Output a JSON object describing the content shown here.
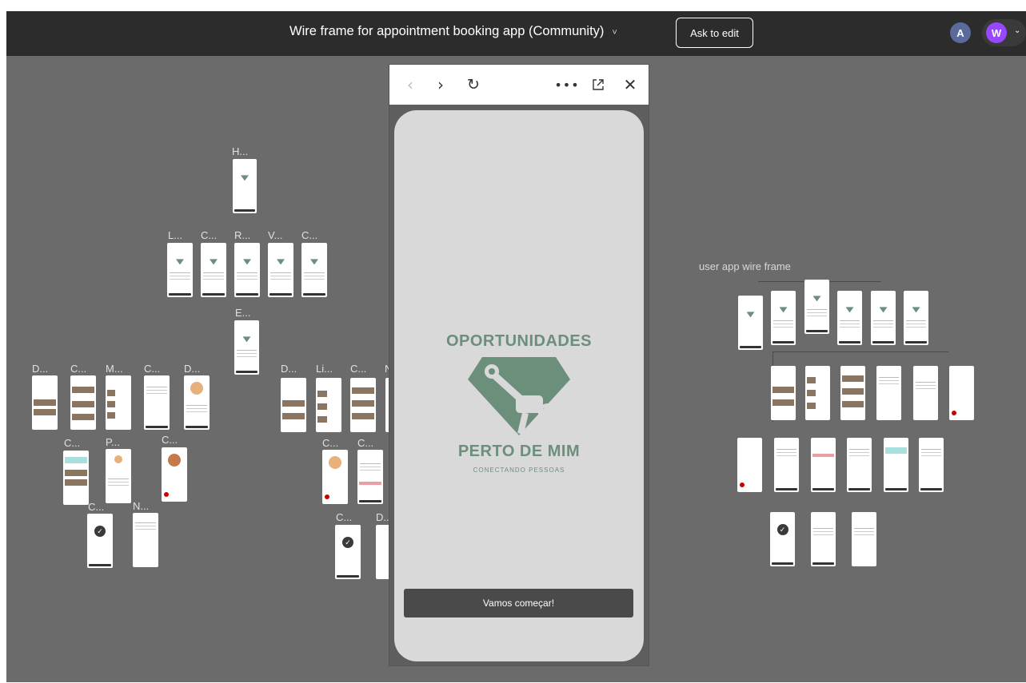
{
  "header": {
    "file_title": "Wire frame for appointment booking app (Community)",
    "title_chevron": "˅",
    "ask_to_edit": "Ask to edit",
    "avatars": [
      {
        "initial": "A",
        "color": "#5a6a9a"
      },
      {
        "initial": "W",
        "color": "#9747ff"
      }
    ]
  },
  "colors": {
    "topbar": "#2c2c2c",
    "canvas": "#6b6b6b",
    "brand_green": "#6b8f7a",
    "phone_bg": "#d9d9d9",
    "button_dark": "#4a4a4a"
  },
  "canvas": {
    "frame_labels": {
      "h": "H...",
      "l": "L...",
      "c1": "C...",
      "r": "R...",
      "v": "V...",
      "c2": "C...",
      "e": "E...",
      "d1": "D...",
      "c3": "C...",
      "m": "M...",
      "c4": "C...",
      "d2": "D...",
      "c5": "C...",
      "p": "P...",
      "c6": "C...",
      "c7": "C...",
      "n": "N...",
      "d3": "D...",
      "li": "Li...",
      "c8": "C...",
      "nn": "N",
      "c9": "C...",
      "c10": "C...",
      "c11": "C...",
      "d4": "D..."
    },
    "user_app_label": "user app wire frame"
  },
  "preview": {
    "toolbar": {
      "back_icon": "‹",
      "forward_icon": "›",
      "reload_icon": "↻",
      "more_icon": "•••",
      "close_icon": "✕"
    },
    "screen": {
      "title_top": "OPORTUNIDADES",
      "title_bottom": "PERTO DE MIM",
      "subtitle": "CONECTANDO PESSOAS",
      "start_button": "Vamos começar!"
    }
  }
}
